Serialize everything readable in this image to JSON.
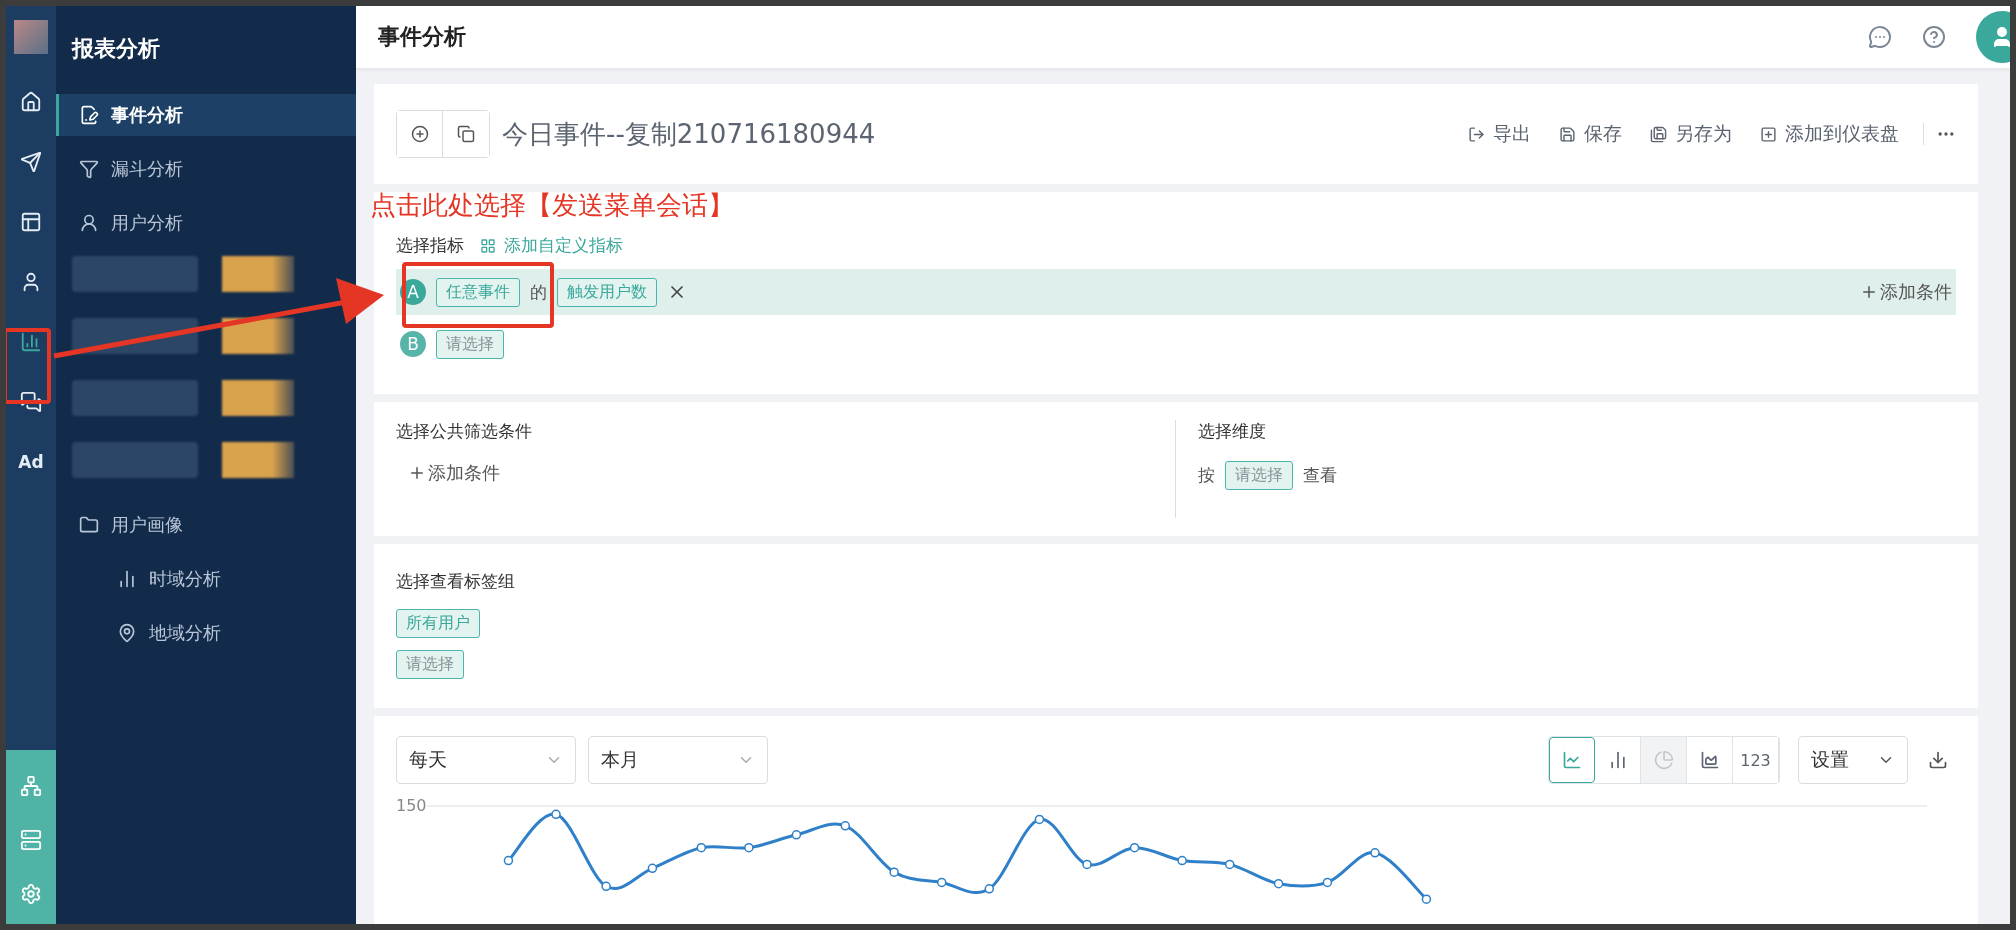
{
  "rail": {
    "items": [
      {
        "kind": "home",
        "selected": false
      },
      {
        "kind": "send",
        "selected": false
      },
      {
        "kind": "layout",
        "selected": false
      },
      {
        "kind": "user",
        "selected": false
      },
      {
        "kind": "chart",
        "selected": true
      },
      {
        "kind": "chat",
        "selected": false
      },
      {
        "kind": "text",
        "label": "Ad",
        "selected": false
      }
    ],
    "bottom": [
      {
        "kind": "network"
      },
      {
        "kind": "server"
      },
      {
        "kind": "settings"
      }
    ]
  },
  "sidebar": {
    "title": "报表分析",
    "items": [
      {
        "label": "事件分析",
        "kind": "edit",
        "selected": true
      },
      {
        "label": "漏斗分析",
        "kind": "funnel",
        "selected": false
      },
      {
        "label": "用户分析",
        "kind": "user",
        "selected": false
      },
      {
        "kind": "blurred"
      },
      {
        "kind": "blurred"
      },
      {
        "kind": "blurred"
      },
      {
        "kind": "blurred"
      },
      {
        "label": "用户画像",
        "kind": "folder",
        "selected": false,
        "children": [
          {
            "label": "时域分析",
            "kind": "bars",
            "selected": false
          },
          {
            "label": "地域分析",
            "kind": "pin",
            "selected": false
          }
        ]
      }
    ]
  },
  "header": {
    "title": "事件分析"
  },
  "report": {
    "title": "今日事件--复制210716180944",
    "actions": [
      {
        "label": "导出",
        "kind": "export"
      },
      {
        "label": "保存",
        "kind": "save"
      },
      {
        "label": "另存为",
        "kind": "save-as"
      },
      {
        "label": "添加到仪表盘",
        "kind": "dashboard"
      }
    ]
  },
  "annotation": {
    "text": "点击此处选择【发送菜单会话】"
  },
  "metrics": {
    "title": "选择指标",
    "custom_link": "添加自定义指标",
    "rows": [
      {
        "letter": "A",
        "event": "任意事件",
        "joiner": "的",
        "measure": "触发用户数",
        "add": "添加条件",
        "active": true
      },
      {
        "letter": "B",
        "event": "请选择",
        "active": false
      }
    ]
  },
  "filters": {
    "title": "选择公共筛选条件",
    "add": "添加条件"
  },
  "dimension": {
    "title": "选择维度",
    "prefix": "按",
    "tag": "请选择",
    "suffix": "查看"
  },
  "tag_groups": {
    "title": "选择查看标签组",
    "tags": [
      {
        "label": "所有用户",
        "filled": true
      },
      {
        "label": "请选择",
        "filled": false
      }
    ]
  },
  "chart_panel": {
    "interval": "每天",
    "range": "本月",
    "types": [
      {
        "kind": "line",
        "selected": true,
        "disabled": false
      },
      {
        "kind": "bar",
        "selected": false,
        "disabled": false
      },
      {
        "kind": "pie",
        "selected": false,
        "disabled": true
      },
      {
        "kind": "area",
        "selected": false,
        "disabled": false
      },
      {
        "kind": "number",
        "label": "123",
        "selected": false,
        "disabled": false
      }
    ],
    "settings": "设置",
    "y_label": "150"
  }
}
